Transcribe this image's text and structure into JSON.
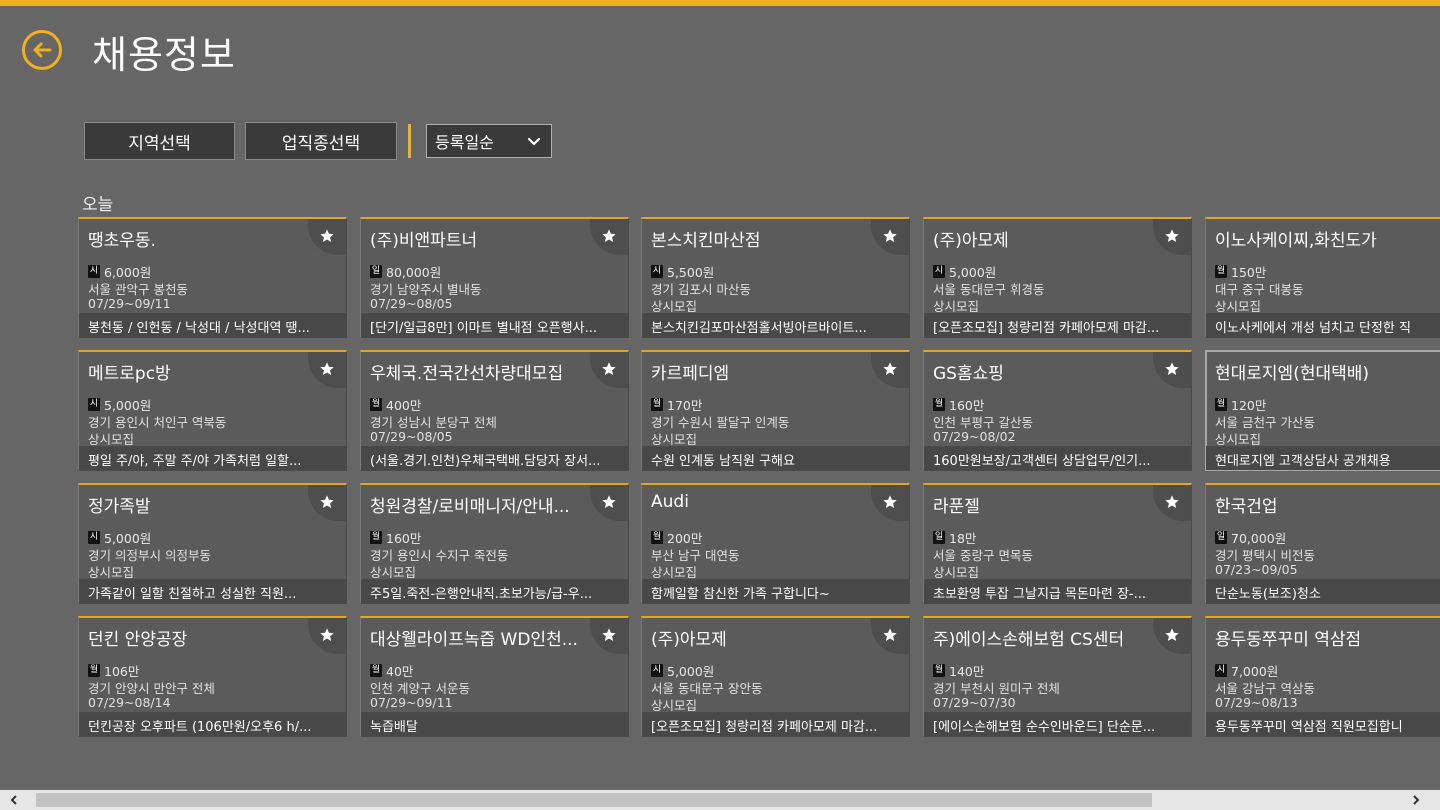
{
  "header": {
    "title": "채용정보"
  },
  "filters": {
    "region_label": "지역선택",
    "job_label": "업직종선택",
    "sort_value": "등록일순"
  },
  "section": {
    "label": "오늘"
  },
  "colors": {
    "accent": "#f0b020",
    "background": "#666666",
    "card": "#5b5b5b"
  },
  "icons": {
    "back": "arrow-left-circle-icon",
    "favorite": "star-icon",
    "dropdown": "chevron-down-icon"
  },
  "cards": [
    {
      "name": "땡초우동.",
      "pay_type": "시",
      "pay": "6,000원",
      "location": "서울 관악구 봉천동",
      "period": "07/29~09/11",
      "desc": "봉천동 / 인헌동 / 낙성대 / 낙성대역 땡..."
    },
    {
      "name": "메트로pc방",
      "pay_type": "시",
      "pay": "5,000원",
      "location": "경기 용인시 처인구 역북동",
      "period": "상시모집",
      "desc": "평일 주/야, 주말 주/야 가족처럼 일할..."
    },
    {
      "name": "정가족발",
      "pay_type": "시",
      "pay": "5,000원",
      "location": "경기 의정부시 의정부동",
      "period": "상시모집",
      "desc": "가족같이 일할 친절하고 성실한 직원..."
    },
    {
      "name": "던킨 안양공장",
      "pay_type": "월",
      "pay": "106만",
      "location": "경기 안양시 만안구 전체",
      "period": "07/29~08/14",
      "desc": "던킨공장 오후파트 (106만원/오후6 h/..."
    },
    {
      "name": "(주)비앤파트너",
      "pay_type": "일",
      "pay": "80,000원",
      "location": "경기 남양주시 별내동",
      "period": "07/29~08/05",
      "desc": "[단기/일급8만] 이마트 별내점 오픈행사..."
    },
    {
      "name": "우체국.전국간선차량대모집",
      "pay_type": "월",
      "pay": "400만",
      "location": "경기 성남시 분당구 전체",
      "period": "07/29~08/05",
      "desc": "(서울.경기.인천)우체국택배.담당자 장서..."
    },
    {
      "name": "청원경찰/로비매니저/안내...",
      "pay_type": "월",
      "pay": "160만",
      "location": "경기 용인시 수지구 죽전동",
      "period": "상시모집",
      "desc": "주5일.죽전-은행안내직.초보가능/급-우..."
    },
    {
      "name": "대상웰라이프녹즙 WD인천...",
      "pay_type": "월",
      "pay": "40만",
      "location": "인천 계양구 서운동",
      "period": "07/29~09/11",
      "desc": "녹즙배달"
    },
    {
      "name": "본스치킨마산점",
      "pay_type": "시",
      "pay": "5,500원",
      "location": "경기 김포시 마산동",
      "period": "상시모집",
      "desc": "본스치킨김포마산점홀서빙아르바이트..."
    },
    {
      "name": "카르페디엠",
      "pay_type": "월",
      "pay": "170만",
      "location": "경기 수원시 팔달구 인계동",
      "period": "상시모집",
      "desc": "수원 인계동 남직원 구해요"
    },
    {
      "name": "Audi",
      "pay_type": "월",
      "pay": "200만",
      "location": "부산 남구 대연동",
      "period": "상시모집",
      "desc": "함께일할 참신한 가족 구합니다~"
    },
    {
      "name": "(주)아모제",
      "pay_type": "시",
      "pay": "5,000원",
      "location": "서울 동대문구 장안동",
      "period": "상시모집",
      "desc": "[오픈조모집] 청량리점 카페아모제 마감..."
    },
    {
      "name": "(주)아모제",
      "pay_type": "시",
      "pay": "5,000원",
      "location": "서울 동대문구 휘경동",
      "period": "상시모집",
      "desc": "[오픈조모집] 청량리점 카페아모제 마감..."
    },
    {
      "name": "GS홈쇼핑",
      "pay_type": "월",
      "pay": "160만",
      "location": "인천 부평구 갈산동",
      "period": "07/29~08/02",
      "desc": "160만원보장/고객센터 상담업무/인기..."
    },
    {
      "name": "라푼젤",
      "pay_type": "일",
      "pay": "18만",
      "location": "서울 중랑구 면목동",
      "period": "상시모집",
      "desc": "초보환영 투잡 그날지급 목돈마련 장-..."
    },
    {
      "name": "주)에이스손해보험 CS센터",
      "pay_type": "월",
      "pay": "140만",
      "location": "경기 부천시 원미구 전체",
      "period": "07/29~07/30",
      "desc": "[에이스손해보험 순수인바운드] 단순문..."
    },
    {
      "name": "이노사케이찌,화친도가",
      "pay_type": "월",
      "pay": "150만",
      "location": "대구 중구 대봉동",
      "period": "상시모집",
      "desc": "이노사케에서 개성 넘치고 단정한 직"
    },
    {
      "name": "현대로지엠(현대택배)",
      "pay_type": "월",
      "pay": "120만",
      "location": "서울 금천구 가산동",
      "period": "상시모집",
      "desc": "현대로지엠 고객상담사 공개채용"
    },
    {
      "name": "한국건업",
      "pay_type": "일",
      "pay": "70,000원",
      "location": "경기 평택시 비전동",
      "period": "07/23~09/05",
      "desc": "단순노동(보조)청소"
    },
    {
      "name": "용두동쭈꾸미 역삼점",
      "pay_type": "시",
      "pay": "7,000원",
      "location": "서울 강남구 역삼동",
      "period": "07/29~08/13",
      "desc": "용두동쭈꾸미 역삼점 직원모집합니"
    }
  ]
}
